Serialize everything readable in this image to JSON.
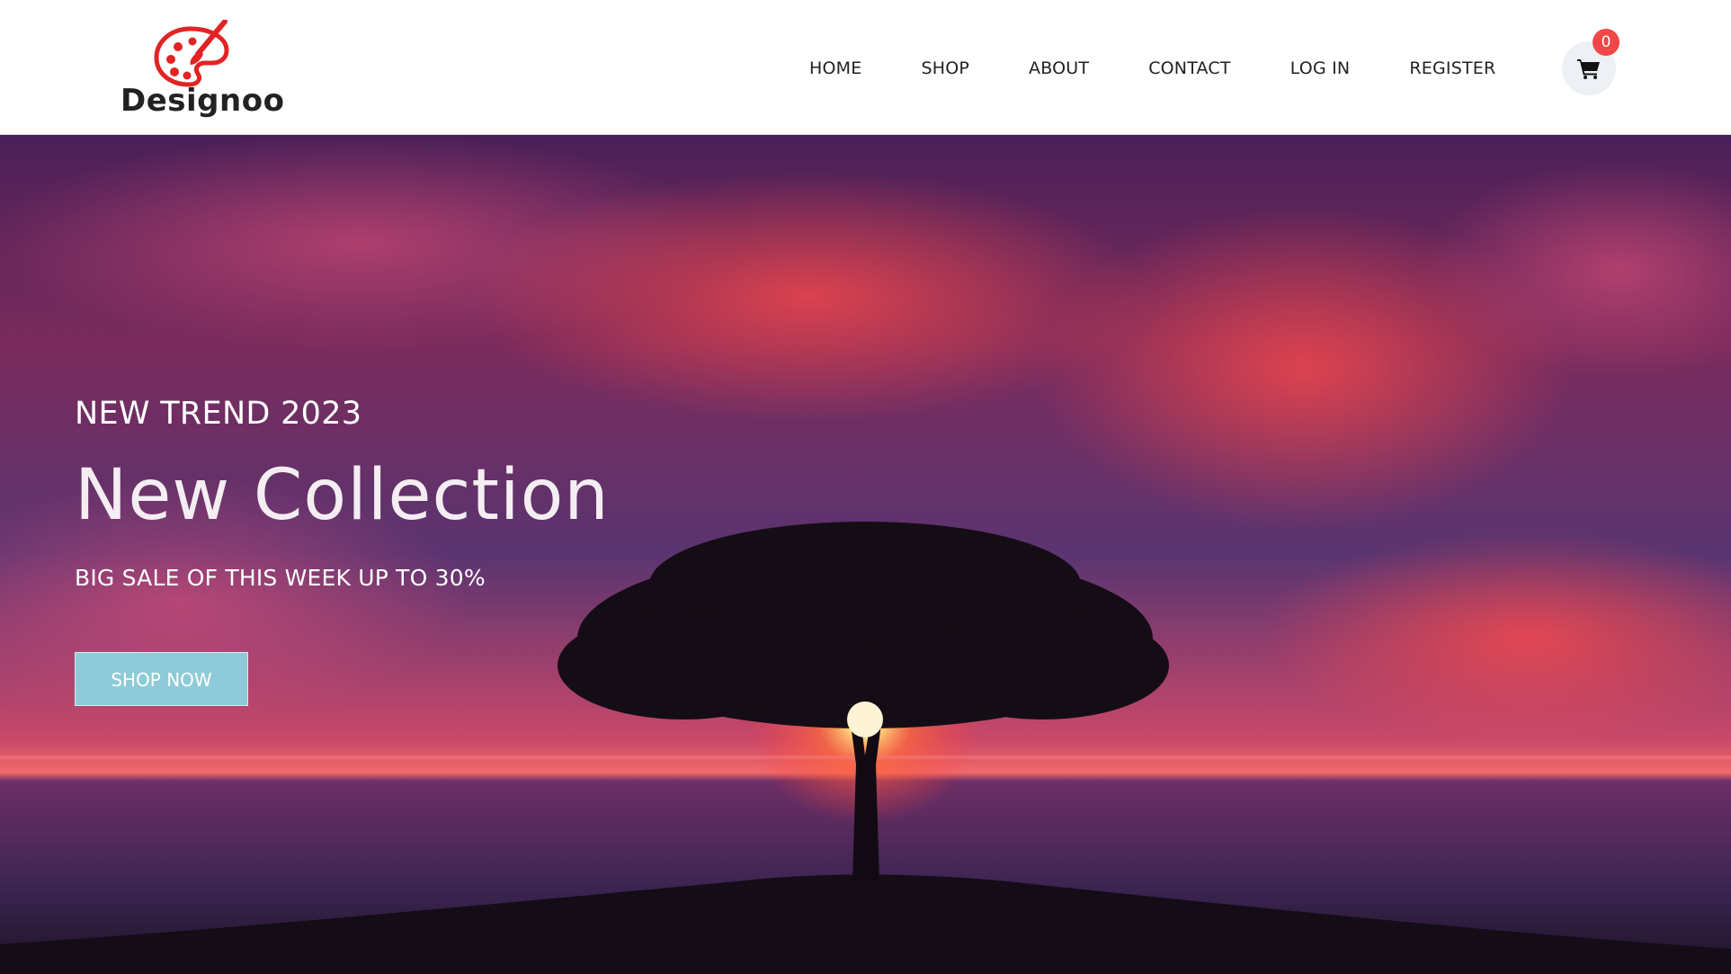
{
  "brand": {
    "name": "Designoo",
    "logo_icon": "palette-icon",
    "accent_color": "#e02424"
  },
  "nav": {
    "items": [
      {
        "label": "HOME"
      },
      {
        "label": "SHOP"
      },
      {
        "label": "ABOUT"
      },
      {
        "label": "CONTACT"
      },
      {
        "label": "LOG IN"
      },
      {
        "label": "REGISTER"
      }
    ]
  },
  "cart": {
    "icon": "cart-icon",
    "count": "0",
    "badge_color": "#f04848"
  },
  "hero": {
    "eyebrow": "NEW TREND 2023",
    "title": "New Collection",
    "subtitle": "BIG SALE OF THIS WEEK UP TO 30%",
    "cta_label": "SHOP NOW",
    "cta_color": "#8ecbd8"
  }
}
